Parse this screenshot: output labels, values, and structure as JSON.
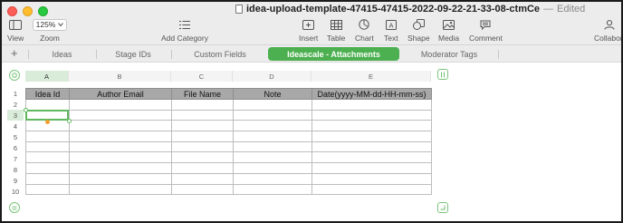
{
  "window": {
    "file_name": "idea-upload-template-47415-47415-2022-09-22-21-33-08-ctmCe",
    "separator": "—",
    "status": "Edited"
  },
  "toolbar": {
    "view_label": "View",
    "zoom_value": "125%",
    "zoom_label": "Zoom",
    "add_category_label": "Add Category",
    "insert_label": "Insert",
    "table_label": "Table",
    "chart_label": "Chart",
    "text_label": "Text",
    "shape_label": "Shape",
    "media_label": "Media",
    "comment_label": "Comment",
    "collaborate_label": "Collabora"
  },
  "sheets": {
    "add_symbol": "+",
    "tabs": [
      {
        "label": "Ideas",
        "active": false
      },
      {
        "label": "Stage IDs",
        "active": false
      },
      {
        "label": "Custom Fields",
        "active": false
      },
      {
        "label": "Ideascale - Attachments",
        "active": true
      },
      {
        "label": "Moderator Tags",
        "active": false
      }
    ]
  },
  "grid": {
    "columns": [
      "A",
      "B",
      "C",
      "D",
      "E"
    ],
    "rows": [
      "1",
      "2",
      "3",
      "4",
      "5",
      "6",
      "7",
      "8",
      "9",
      "10"
    ],
    "selected_column": "A",
    "selected_row": "3",
    "headers": [
      "Idea Id",
      "Author Email",
      "File Name",
      "Note",
      "Date(yyyy-MM-dd-HH-mm-ss)"
    ]
  },
  "colors": {
    "accent": "#4caf50",
    "header_fill": "#a8a8a8",
    "selection": "#5fb85f"
  }
}
